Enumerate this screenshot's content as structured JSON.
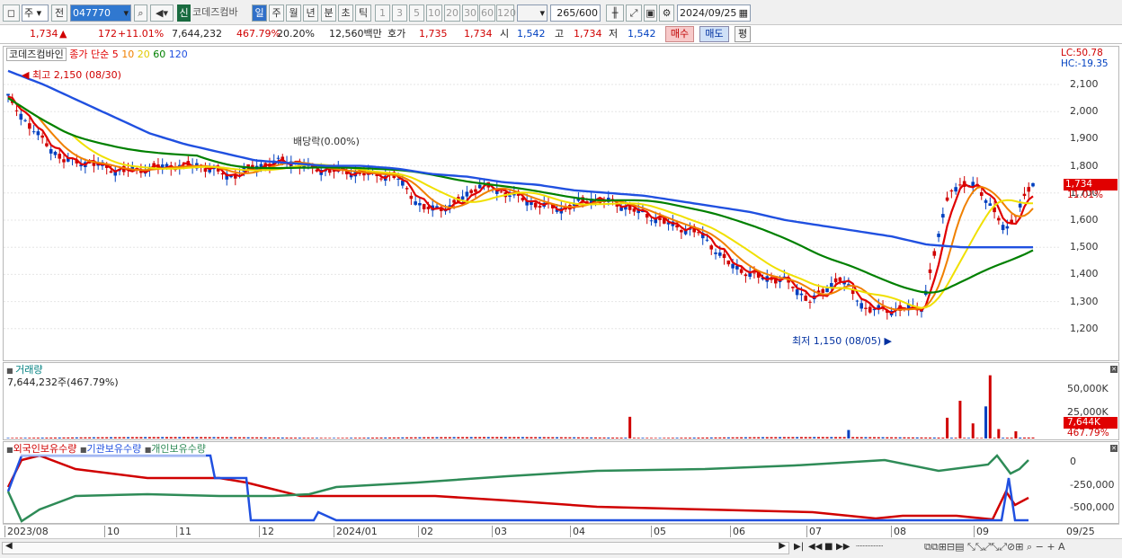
{
  "toolbar": {
    "market": "주",
    "prev_label": "전",
    "code": "047770",
    "new_badge": "신",
    "stock_name": "코데즈컴바",
    "periods": [
      "일",
      "주",
      "월",
      "년",
      "분",
      "초",
      "틱"
    ],
    "intervals": [
      "1",
      "3",
      "5",
      "10",
      "20",
      "30",
      "60",
      "120"
    ],
    "count": "265",
    "count_total": "/600",
    "date": "2024/09/25"
  },
  "quote": {
    "price": "1,734",
    "up_arrow": "▲",
    "change": "172",
    "change_pct": "+11.01%",
    "volume": "7,644,232",
    "vol_ratio": "467.79%",
    "turnover": "20.20%",
    "amount": "12,560백만",
    "hoga_label": "호가",
    "hoga1": "1,735",
    "hoga2": "1,734",
    "open_label": "시",
    "open": "1,542",
    "high_label": "고",
    "high": "1,734",
    "low_label": "저",
    "low": "1,542",
    "buy_label": "매수",
    "sell_label": "매도",
    "avg_label": "평"
  },
  "price_panel": {
    "legend": {
      "name": "코데즈컴바인",
      "type": "종가 단순",
      "ma": [
        "5",
        "10",
        "20",
        "60",
        "120"
      ]
    },
    "lc": "LC:50.78",
    "hc": "HC:-19.35",
    "high_note": "최고 2,150 (08/30)",
    "low_note": "최저 1,150 (08/05)",
    "dividend_note": "배당락(0.00%)",
    "current": "1,734",
    "current_pct": "11.01%",
    "y_ticks": [
      "2,100",
      "2,000",
      "1,900",
      "1,800",
      "1,700",
      "1,600",
      "1,500",
      "1,400",
      "1,300",
      "1,200"
    ]
  },
  "volume_panel": {
    "title": "거래량",
    "value": "7,644,232주(467.79%)",
    "y_ticks": [
      "50,000K",
      "25,000K"
    ],
    "current": "7,644K",
    "current_pct": "467.79%"
  },
  "holding_panel": {
    "legend": [
      "외국인보유수량",
      "기관보유수량",
      "개인보유수량"
    ],
    "y_ticks": [
      "0",
      "-250,000",
      "-500,000"
    ]
  },
  "x_ticks": [
    "2023/08",
    "10",
    "11",
    "12",
    "2024/01",
    "02",
    "03",
    "04",
    "05",
    "06",
    "07",
    "08",
    "09"
  ],
  "x_last": "09/25",
  "colors": {
    "ma5": "#e00000",
    "ma10": "#f08000",
    "ma20": "#f0e000",
    "ma60": "#008000",
    "ma120": "#2050e0",
    "up": "#d00000",
    "down": "#0040c0",
    "foreign": "#d00000",
    "inst": "#2050e0",
    "indiv": "#2e8b57"
  },
  "chart_data": {
    "type": "candlestick",
    "ohlc_approx": [
      2050,
      1920,
      1820,
      1810,
      1780,
      1790,
      1800,
      1800,
      1760,
      1800,
      1820,
      1790,
      1780,
      1770,
      1760,
      1640,
      1650,
      1730,
      1700,
      1660,
      1640,
      1680,
      1660,
      1620,
      1580,
      1550,
      1440,
      1390,
      1380,
      1300,
      1390,
      1270,
      1270,
      1280,
      1720,
      1730,
      1560,
      1734
    ],
    "ma120_approx": [
      2150,
      2100,
      2040,
      1980,
      1920,
      1880,
      1850,
      1820,
      1810,
      1800,
      1800,
      1790,
      1770,
      1760,
      1740,
      1730,
      1710,
      1700,
      1690,
      1670,
      1650,
      1630,
      1600,
      1580,
      1560,
      1540,
      1510,
      1500,
      1500,
      1500
    ]
  }
}
